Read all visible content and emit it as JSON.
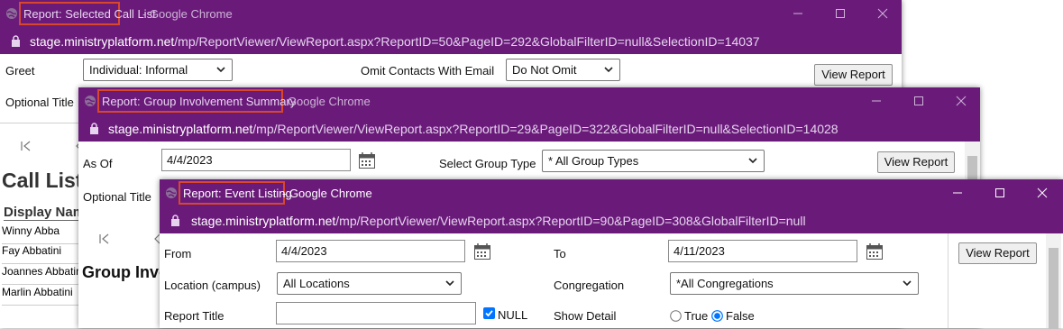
{
  "windows": {
    "w1": {
      "title_highlight": "Report: Selected Call List",
      "title_rest": " - Google Chrome",
      "url_host": "stage.ministryplatform.net",
      "url_path": "/mp/ReportViewer/ViewReport.aspx?ReportID=50&PageID=292&GlobalFilterID=null&SelectionID=14037",
      "greet_label": "Greet",
      "greet_value": "Individual: Informal",
      "omit_label": "Omit Contacts With Email",
      "omit_value": "Do Not Omit",
      "view_report": "View Report",
      "optional_title_label": "Optional Title",
      "report_heading": "Call List",
      "column_header": "Display Name",
      "rows": [
        "Winny Abba",
        "Fay Abbatini",
        "Joannes Abbatini",
        "Marlin Abbatini"
      ]
    },
    "w2": {
      "title_highlight": "Report: Group Involvement Summary",
      "title_rest": " - Google Chrome",
      "url_host": "stage.ministryplatform.net",
      "url_path": "/mp/ReportViewer/ViewReport.aspx?ReportID=29&PageID=322&GlobalFilterID=null&SelectionID=14028",
      "as_of_label": "As Of",
      "as_of_value": "4/4/2023",
      "group_type_label": "Select Group Type",
      "group_type_value": "* All Group Types",
      "view_report": "View Report",
      "optional_title_label": "Optional Title",
      "report_heading": "Group Involvement Summary"
    },
    "w3": {
      "title_highlight": "Report: Event Listing",
      "title_rest": " - Google Chrome",
      "url_host": "stage.ministryplatform.net",
      "url_path": "/mp/ReportViewer/ViewReport.aspx?ReportID=90&PageID=308&GlobalFilterID=null",
      "from_label": "From",
      "from_value": "4/4/2023",
      "to_label": "To",
      "to_value": "4/11/2023",
      "location_label": "Location (campus)",
      "location_value": "All Locations",
      "congregation_label": "Congregation",
      "congregation_value": "*All Congregations",
      "report_title_label": "Report Title",
      "report_title_value": "",
      "null_label": "NULL",
      "null_checked": true,
      "show_detail_label": "Show Detail",
      "true_label": "True",
      "false_label": "False",
      "show_detail_selected": "False",
      "view_report": "View Report"
    }
  },
  "colors": {
    "chrome_purple": "#6a1b7a",
    "highlight_border": "#d9472b"
  }
}
